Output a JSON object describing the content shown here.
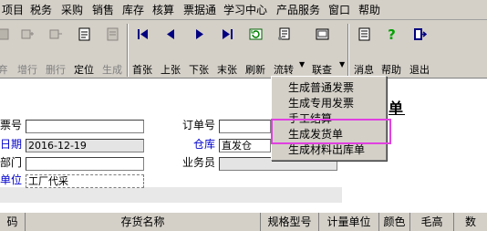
{
  "menubar": {
    "items": [
      "项目",
      "税务",
      "采购",
      "销售",
      "库存",
      "核算",
      "票据通",
      "学习中心",
      "产品服务",
      "窗口",
      "帮助"
    ]
  },
  "toolbar": {
    "buttons": [
      {
        "label": "弃",
        "icon": "discard-icon",
        "disabled": true
      },
      {
        "label": "增行",
        "icon": "add-row-icon",
        "disabled": true
      },
      {
        "label": "删行",
        "icon": "delete-row-icon",
        "disabled": true
      },
      {
        "label": "定位",
        "icon": "locate-icon",
        "disabled": false
      },
      {
        "label": "生成",
        "icon": "generate-icon",
        "disabled": true
      },
      {
        "label": "首张",
        "icon": "first-record-icon",
        "disabled": false
      },
      {
        "label": "上张",
        "icon": "previous-record-icon",
        "disabled": false
      },
      {
        "label": "下张",
        "icon": "next-record-icon",
        "disabled": false
      },
      {
        "label": "末张",
        "icon": "last-record-icon",
        "disabled": false
      },
      {
        "label": "刷新",
        "icon": "refresh-icon",
        "disabled": false
      },
      {
        "label": "流转",
        "icon": "flow-icon",
        "disabled": false
      },
      {
        "label": "联查",
        "icon": "linked-query-icon",
        "disabled": false
      },
      {
        "label": "消息",
        "icon": "message-icon",
        "disabled": false
      },
      {
        "label": "帮助",
        "icon": "help-icon",
        "disabled": false
      },
      {
        "label": "退出",
        "icon": "exit-icon",
        "disabled": false
      }
    ]
  },
  "dropdown": {
    "items": [
      "生成普通发票",
      "生成专用发票",
      "手工结算",
      "生成发货单",
      "生成材料出库单"
    ],
    "highlight_color": "#e040e0"
  },
  "form": {
    "title_fragment": "单",
    "labels": {
      "ticket_no": "票号",
      "date": "日期",
      "department": "部门",
      "unit": "单位",
      "order_no": "订单号",
      "warehouse": "仓库",
      "salesperson": "业务员"
    },
    "values": {
      "ticket_no": "",
      "date": "2016-12-19",
      "department": "",
      "unit": "工厂代采",
      "order_no": "",
      "warehouse": "直发仓",
      "salesperson": ""
    }
  },
  "grid": {
    "columns": [
      "码",
      "存货名称",
      "规格型号",
      "计量单位",
      "颜色",
      "毛高",
      "数"
    ]
  },
  "colors": {
    "chrome": "#d4d0c8",
    "label_blue": "#0000cc",
    "highlight": "#e040e0"
  }
}
